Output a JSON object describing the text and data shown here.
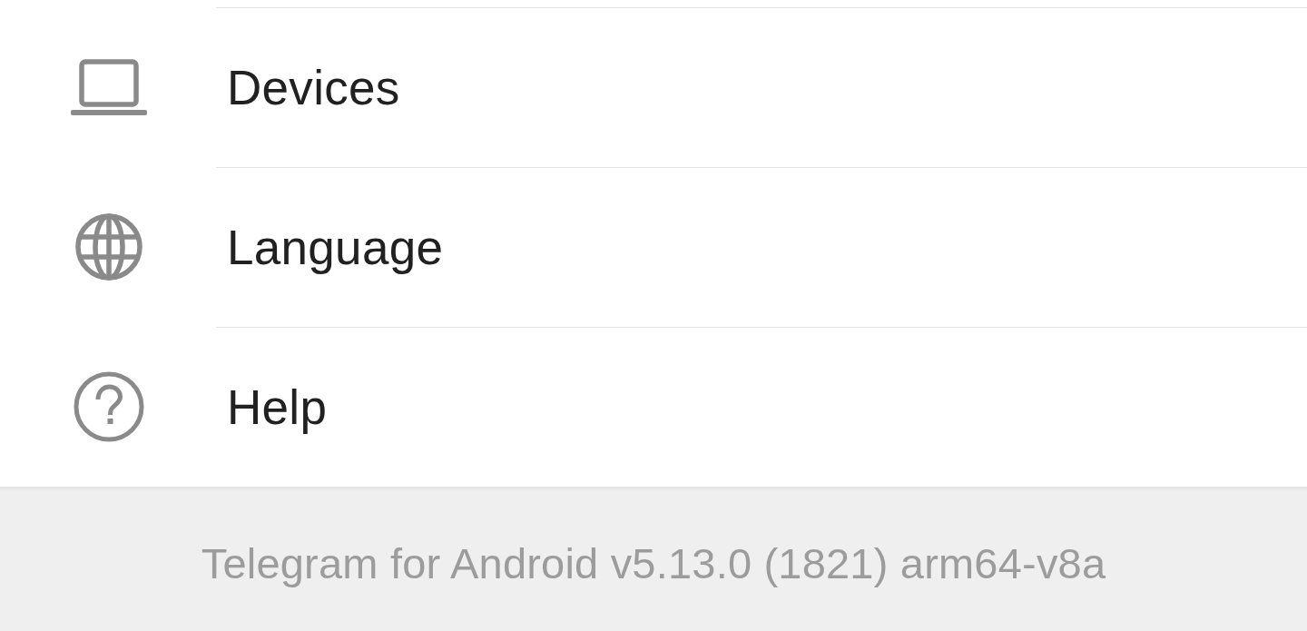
{
  "menu": {
    "items": [
      {
        "kind": "laptop",
        "label": "Devices"
      },
      {
        "kind": "globe",
        "label": "Language"
      },
      {
        "kind": "help",
        "label": "Help"
      }
    ]
  },
  "footer": {
    "version": "Telegram for Android v5.13.0 (1821) arm64-v8a"
  }
}
